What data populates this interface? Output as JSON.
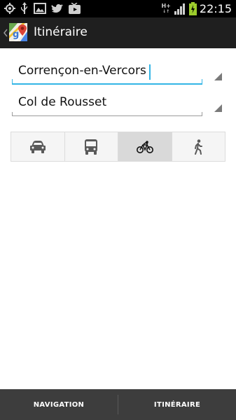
{
  "status_bar": {
    "time": "22:15",
    "network": "H+",
    "icons": [
      "gps-icon",
      "usb-icon",
      "image-icon",
      "twitter-icon",
      "youtube-icon",
      "signal-icon",
      "battery-charging-icon"
    ]
  },
  "action_bar": {
    "title": "Itinéraire",
    "app_icon": "maps-icon"
  },
  "route": {
    "from_value": "Corrençon-en-Vercors",
    "to_value": "Col de Rousset"
  },
  "travel_modes": [
    {
      "name": "car",
      "icon": "car-icon",
      "selected": false
    },
    {
      "name": "transit",
      "icon": "bus-icon",
      "selected": false
    },
    {
      "name": "bicycle",
      "icon": "bicycle-icon",
      "selected": true
    },
    {
      "name": "walk",
      "icon": "walk-icon",
      "selected": false
    }
  ],
  "bottom_bar": {
    "navigation_label": "NAVIGATION",
    "itinerary_label": "ITINÉRAIRE"
  },
  "colors": {
    "accent": "#33b5e5",
    "action_bar": "#1f1f1f",
    "bottom_bar": "#3d3d3d"
  }
}
